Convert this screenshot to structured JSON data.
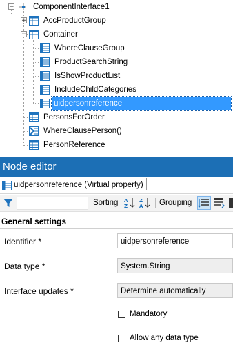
{
  "tree": {
    "nodes": [
      {
        "label": "ComponentInterface1",
        "icon": "component-interface-icon",
        "expanded": true,
        "selected": false
      },
      {
        "label": "AccProductGroup",
        "icon": "table-icon",
        "expanded": false,
        "selected": false
      },
      {
        "label": "Container",
        "icon": "table-icon",
        "expanded": true,
        "selected": false
      },
      {
        "label": "WhereClauseGroup",
        "icon": "property-icon",
        "selected": false
      },
      {
        "label": "ProductSearchString",
        "icon": "property-icon",
        "selected": false
      },
      {
        "label": "IsShowProductList",
        "icon": "property-icon",
        "selected": false
      },
      {
        "label": "IncludeChildCategories",
        "icon": "property-icon",
        "selected": false
      },
      {
        "label": "uidpersonreference",
        "icon": "property-icon",
        "selected": true
      },
      {
        "label": "PersonsForOrder",
        "icon": "table-icon",
        "selected": false
      },
      {
        "label": "WhereClausePerson()",
        "icon": "method-icon",
        "selected": false
      },
      {
        "label": "PersonReference",
        "icon": "table-icon",
        "selected": false
      }
    ]
  },
  "editor": {
    "title": "Node editor",
    "node_tab": "uidpersonreference (Virtual property)",
    "toolbar": {
      "sorting_label": "Sorting",
      "grouping_label": "Grouping"
    },
    "section": "General settings",
    "fields": {
      "identifier_label": "Identifier *",
      "identifier_value": "uidpersonreference",
      "datatype_label": "Data type *",
      "datatype_value": "System.String",
      "updates_label": "Interface updates *",
      "updates_value": "Determine automatically"
    },
    "checkboxes": {
      "mandatory_label": "Mandatory",
      "mandatory_checked": false,
      "any_type_label": "Allow any data type",
      "any_type_checked": false
    }
  },
  "colors": {
    "selection": "#3399ff",
    "title_bar": "#1c6fb5",
    "accent_icon": "#1e73be"
  }
}
